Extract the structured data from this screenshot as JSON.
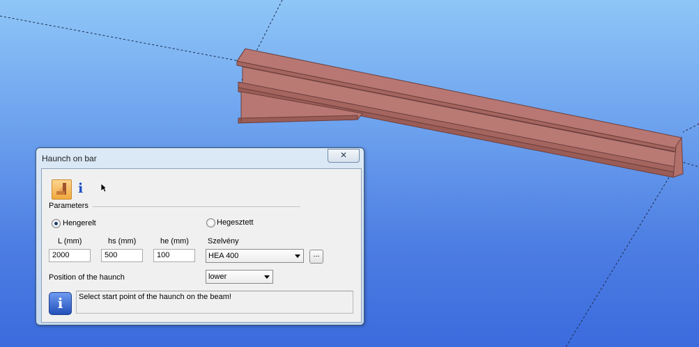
{
  "dialog": {
    "title": "Haunch on bar",
    "close_glyph": "✕",
    "toolbar": {
      "haunch_icon": "haunch-tool-icon",
      "info_glyph": "i",
      "pointer_icon": "mouse-pointer-icon"
    },
    "parameters_label": "Parameters",
    "radio_rolled": "Hengerelt",
    "radio_welded": "Hegesztett",
    "selected_type": "Hengerelt",
    "labels": {
      "L": "L (mm)",
      "hs": "hs (mm)",
      "he": "he (mm)",
      "section": "Szelvény"
    },
    "values": {
      "L": "2000",
      "hs": "500",
      "he": "100",
      "section": "HEA 400"
    },
    "browse_label": "...",
    "position_label": "Position of the haunch",
    "position_value": "lower",
    "message_icon_glyph": "i",
    "message": "Select start point of the haunch on the beam!"
  },
  "colors": {
    "beam": "#b87772",
    "beam_edge": "#6b3e3b",
    "sky_top": "#8ec6f7",
    "sky_bottom": "#3b6bdd"
  }
}
